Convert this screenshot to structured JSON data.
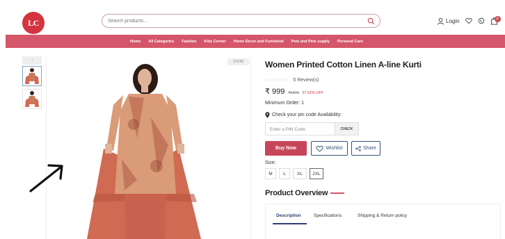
{
  "header": {
    "logo_text": "LC",
    "search_placeholder": "Search products...",
    "login_label": "Login",
    "cart_count": "0"
  },
  "nav": {
    "items": [
      "Home",
      "All Categories",
      "Fashion",
      "Kids Corner",
      "Home Decor and Furnished",
      "Pets and Pets supply",
      "Personal Care"
    ]
  },
  "gallery": {
    "zoom_label": "ZOOM",
    "scroll_up": "↑"
  },
  "product": {
    "title": "Women Printed Cotton Linen A-line Kurti",
    "stars": "☆☆☆☆☆",
    "reviews": "0 Review(s)",
    "price": "₹ 999",
    "mrp": "₹1600",
    "discount": "37.52% OFF",
    "min_order": "Minimum Order: 1",
    "pin_question": "Check your pin code Availability:",
    "pin_placeholder": "Enter a PIN Code",
    "check_label": "CHECK",
    "buy_label": "Buy Now",
    "wishlist_label": "Wishlist",
    "share_label": "Share",
    "size_label": "Size:",
    "sizes": [
      "M",
      "L",
      "XL",
      "2XL"
    ],
    "overview_title": "Product Overview"
  },
  "tabs": [
    "Description",
    "Specifications",
    "Shipping & Return policy"
  ],
  "colors": {
    "brand": "#d4343f",
    "nav_bg": "#d5566a",
    "buy_bg": "#c7455a",
    "accent_dark": "#2f3d72"
  }
}
